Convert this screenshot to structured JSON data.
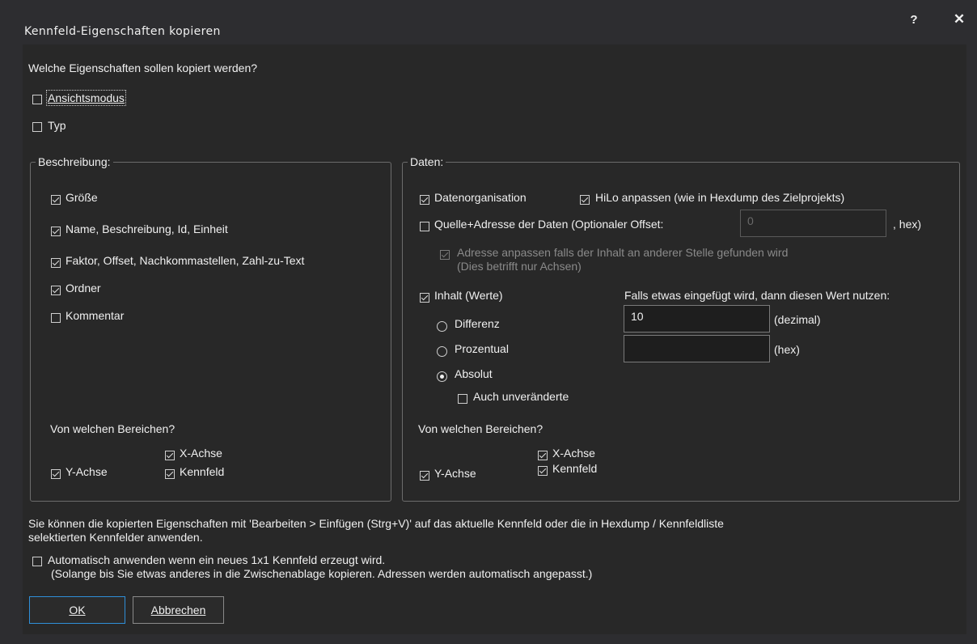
{
  "window": {
    "title": "Kennfeld-Eigenschaften kopieren",
    "help_label": "?",
    "close_label": "✕"
  },
  "question": "Welche Eigenschaften sollen kopiert werden?",
  "top_options": [
    {
      "label": "Ansichtsmodus",
      "checked": false
    },
    {
      "label": "Typ",
      "checked": false
    }
  ],
  "beschreibung": {
    "legend": "Beschreibung:",
    "items": [
      {
        "label": "Größe",
        "checked": true
      },
      {
        "label": "Name, Beschreibung, Id, Einheit",
        "checked": true
      },
      {
        "label": "Faktor, Offset, Nachkommastellen, Zahl-zu-Text",
        "checked": true
      },
      {
        "label": "Ordner",
        "checked": true
      },
      {
        "label": "Kommentar",
        "checked": false
      }
    ],
    "bereiche_label": "Von welchen Bereichen?",
    "x_achse": "X-Achse",
    "y_achse": "Y-Achse",
    "kennfeld": "Kennfeld"
  },
  "daten": {
    "legend": "Daten:",
    "datenorganisation": "Datenorganisation",
    "hilo": "HiLo anpassen (wie in Hexdump des Zielprojekts)",
    "quelle": "Quelle+Adresse der Daten (Optionaler Offset:",
    "offset_value": "0",
    "hex_suffix": ", hex)",
    "adresse_line1": "Adresse anpassen falls der Inhalt an anderer Stelle gefunden wird",
    "adresse_line2": "(Dies betrifft nur Achsen)",
    "inhalt": "Inhalt (Werte)",
    "falls_label": "Falls etwas eingefügt wird, dann diesen Wert nutzen:",
    "differenz": "Differenz",
    "prozentual": "Prozentual",
    "absolut": "Absolut",
    "auch_unveraenderte": "Auch unveränderte",
    "dezimal_value": "10",
    "dezimal_label": "(dezimal)",
    "hex_value": "",
    "hex_label": "(hex)",
    "bereiche_label": "Von welchen Bereichen?",
    "x_achse": "X-Achse",
    "y_achse": "Y-Achse",
    "kennfeld": "Kennfeld"
  },
  "info_line1": "Sie können die kopierten Eigenschaften mit 'Bearbeiten > Einfügen (Strg+V)' auf das aktuelle Kennfeld oder die in Hexdump / Kennfeldliste",
  "info_line2": "selektierten Kennfelder anwenden.",
  "auto_label": "Automatisch anwenden wenn ein neues 1x1 Kennfeld erzeugt wird.",
  "auto_sub": "(Solange bis Sie etwas anderes in die Zwischenablage kopieren. Adressen werden automatisch angepasst.)",
  "buttons": {
    "ok": "OK",
    "cancel": "Abbrechen"
  }
}
